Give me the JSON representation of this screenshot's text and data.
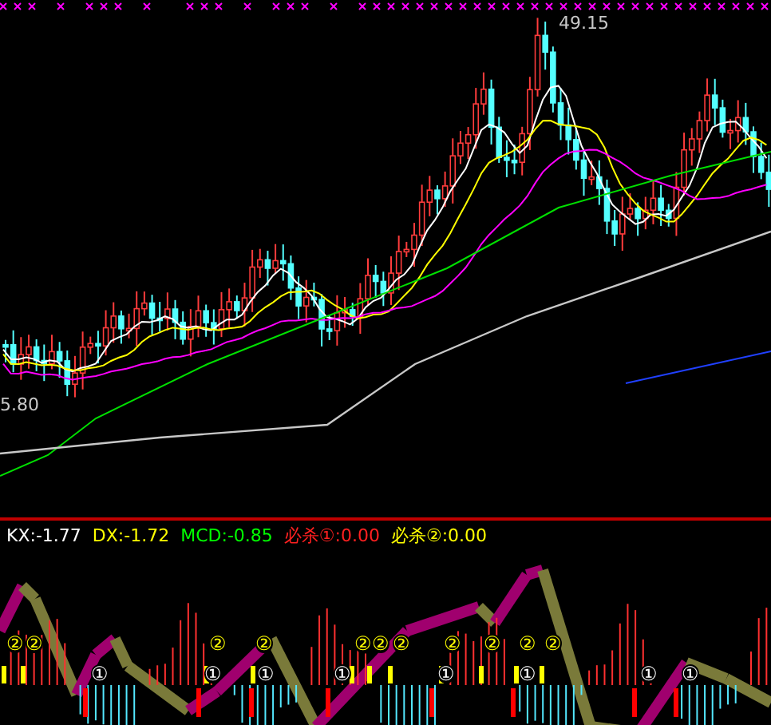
{
  "price_chart": {
    "high_label": "49.15",
    "low_label": "5.80"
  },
  "indicator": {
    "legend": [
      {
        "text": "KX:-1.77",
        "color": "#ffffff"
      },
      {
        "text": "DX:-1.72",
        "color": "#ffff00"
      },
      {
        "text": "MCD:-0.85",
        "color": "#00ff00"
      },
      {
        "text": "必杀①:0.00",
        "color": "#ff2020"
      },
      {
        "text": "必杀②:0.00",
        "color": "#ffff00"
      }
    ],
    "signal_rows": [
      {
        "kind": "kill2",
        "markers": [
          "②",
          "②",
          "②",
          "②",
          "②",
          "②",
          "②",
          "②",
          "②",
          "②",
          "②"
        ]
      },
      {
        "kind": "kill1",
        "markers": [
          "①",
          "①",
          "①",
          "①",
          "①",
          "①",
          "①",
          "①"
        ]
      }
    ]
  }
}
